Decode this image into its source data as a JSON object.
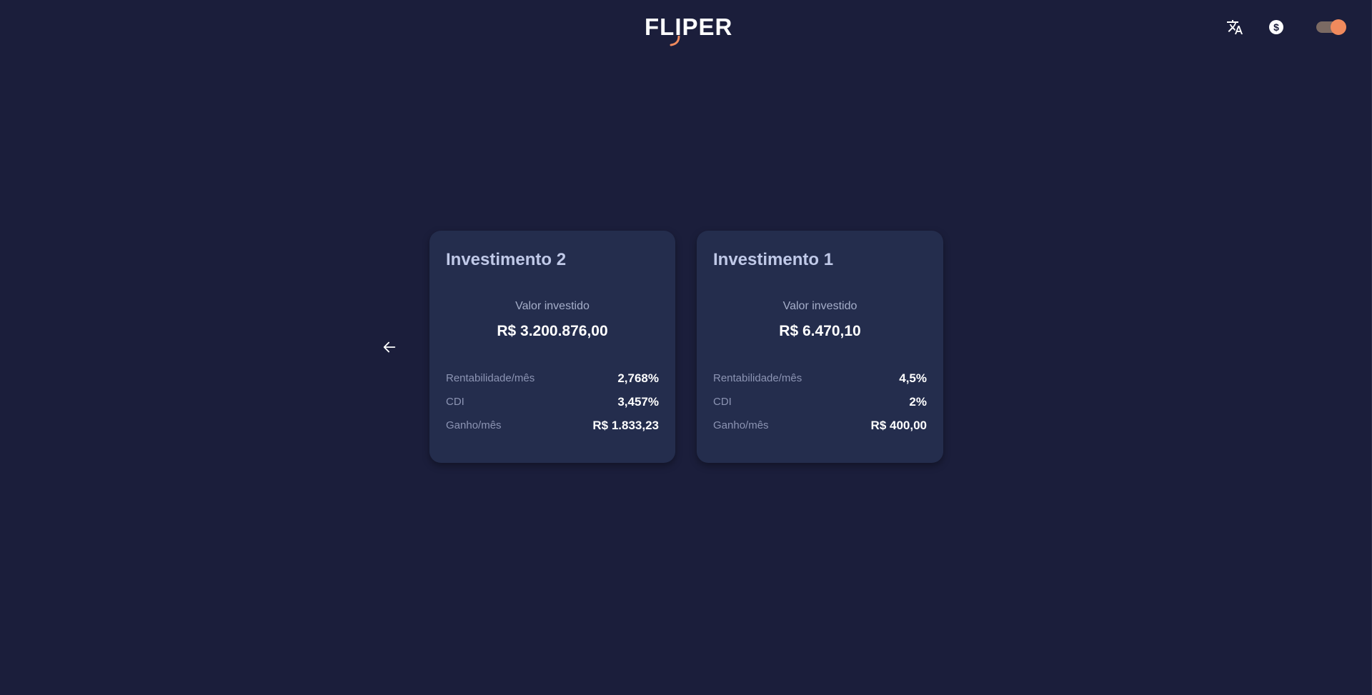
{
  "header": {
    "logo_text": "FLIPER",
    "icons": [
      "translate-icon",
      "dollar-icon",
      "theme-toggle"
    ],
    "accent_color": "#f08a5d"
  },
  "investments": [
    {
      "title": "Investimento 2",
      "invested_label": "Valor investido",
      "invested_value": "R$ 3.200.876,00",
      "rows": [
        {
          "label": "Rentabilidade/mês",
          "value": "2,768%"
        },
        {
          "label": "CDI",
          "value": "3,457%"
        },
        {
          "label": "Ganho/mês",
          "value": "R$ 1.833,23"
        }
      ]
    },
    {
      "title": "Investimento 1",
      "invested_label": "Valor investido",
      "invested_value": "R$ 6.470,10",
      "rows": [
        {
          "label": "Rentabilidade/mês",
          "value": "4,5%"
        },
        {
          "label": "CDI",
          "value": "2%"
        },
        {
          "label": "Ganho/mês",
          "value": "R$ 400,00"
        }
      ]
    }
  ],
  "colors": {
    "background": "#1b1e3b",
    "card": "#242d4d",
    "title": "#c0c9e8"
  }
}
